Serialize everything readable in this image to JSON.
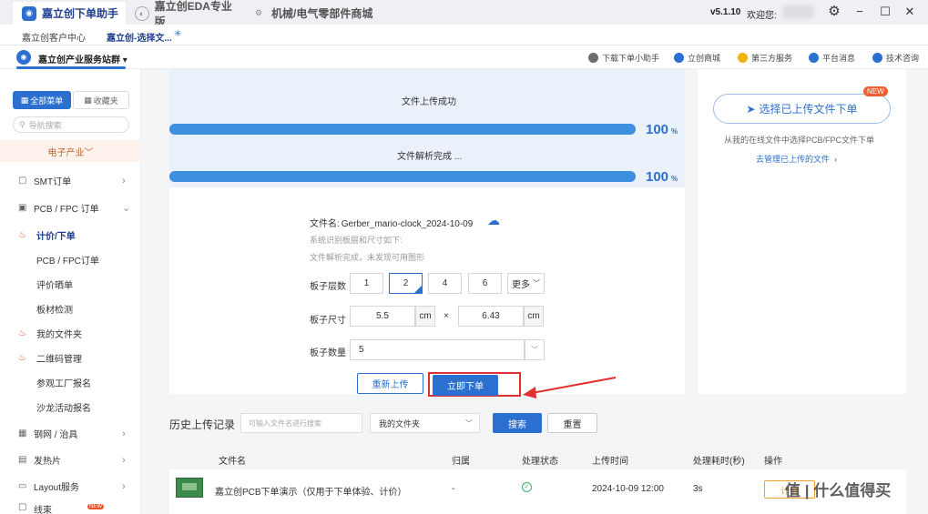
{
  "titlebar": {
    "tabs": [
      {
        "label": "嘉立创下单助手"
      },
      {
        "label": "嘉立创EDA专业版"
      },
      {
        "label": "机械/电气零部件商城"
      }
    ],
    "version": "v5.1.10",
    "welcome": "欢迎您: ",
    "colors": {
      "accent": "#2b6fd1",
      "brand": "#1f3e8f"
    }
  },
  "subtabs": [
    {
      "label": "嘉立创客户中心"
    },
    {
      "label": "嘉立创-选择文..."
    }
  ],
  "toolbar": {
    "station": "嘉立创产业服务站群",
    "links": [
      {
        "label": "下载下单小助手",
        "icon": "download-helper-icon"
      },
      {
        "label": "立创商城",
        "icon": "mall-icon"
      },
      {
        "label": "第三方服务",
        "icon": "third-party-icon"
      },
      {
        "label": "平台消息",
        "icon": "bell-icon"
      },
      {
        "label": "技术咨询",
        "icon": "consult-icon"
      }
    ]
  },
  "sidebar": {
    "tab_all": "全部菜单",
    "tab_fav": "收藏夹",
    "search_placeholder": "导航搜索",
    "category": "电子产业",
    "items": [
      {
        "label": "SMT订单"
      },
      {
        "label": "PCB / FPC 订单"
      },
      {
        "label": "计价/下单"
      },
      {
        "label": "PCB / FPC订单"
      },
      {
        "label": "评价晒单"
      },
      {
        "label": "板材检测"
      },
      {
        "label": "我的文件夹"
      },
      {
        "label": "二维码管理"
      },
      {
        "label": "参观工厂报名"
      },
      {
        "label": "沙龙活动报名"
      },
      {
        "label": "钢网 / 治具"
      },
      {
        "label": "发热片"
      },
      {
        "label": "Layout服务"
      },
      {
        "label": "线束"
      }
    ],
    "new_badge": "NEW"
  },
  "upload": {
    "status1": "文件上传成功",
    "progress1": 100,
    "status2": "文件解析完成 ...",
    "progress2": 100,
    "pct_unit": "%",
    "file_label": "文件名:",
    "file_name": "Gerber_mario-clock_2024-10-09",
    "info1": "系统识别板层和尺寸如下:",
    "info2": "文件解析完成，未发现可用图形",
    "layers_label": "板子层数",
    "layers": [
      "1",
      "2",
      "4",
      "6"
    ],
    "layers_selected": "2",
    "layers_more": "更多",
    "size_label": "板子尺寸",
    "size_w": "5.5",
    "size_h": "6.43",
    "size_unit": "cm",
    "size_x": "×",
    "qty_label": "板子数量",
    "qty_value": "5",
    "reupload": "重新上传",
    "order_now": "立即下单"
  },
  "right_panel": {
    "badge": "NEW",
    "select_btn": "选择已上传文件下单",
    "desc": "从我的在线文件中选择PCB/FPC文件下单",
    "manage_link": "去管理已上传的文件"
  },
  "history": {
    "title": "历史上传记录",
    "search_placeholder": "可输入文件名进行搜索",
    "folder": "我的文件夹",
    "search_btn": "搜索",
    "reset_btn": "重置",
    "columns": [
      "文件名",
      "归属",
      "处理状态",
      "上传时间",
      "处理耗时(秒)",
      "操作"
    ],
    "rows": [
      {
        "name": "嘉立创PCB下单演示（仅用于下单体验、计价）",
        "owner": "-",
        "time": "2024-10-09 12:00",
        "duration": "3s",
        "action": "计价"
      }
    ]
  },
  "watermark": "值 | 什么值得买"
}
